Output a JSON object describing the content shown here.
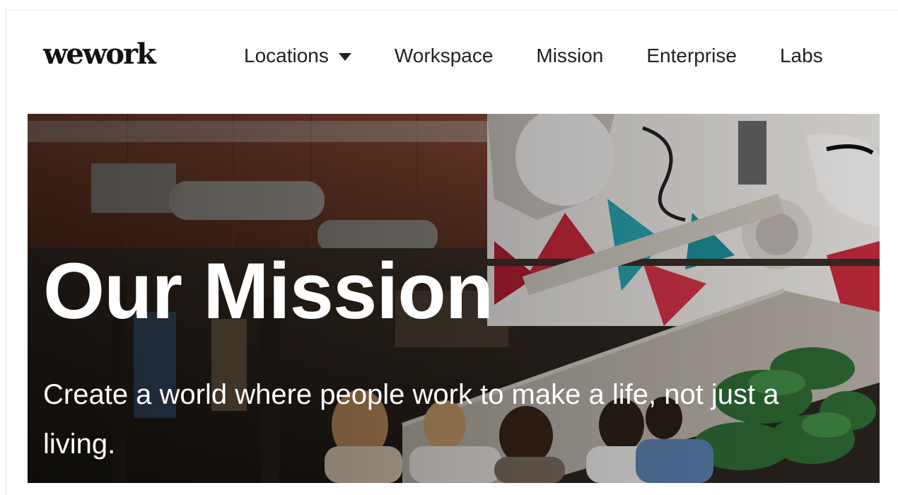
{
  "header": {
    "logo": "wework",
    "nav": [
      {
        "label": "Locations",
        "has_dropdown": true
      },
      {
        "label": "Workspace"
      },
      {
        "label": "Mission"
      },
      {
        "label": "Enterprise"
      },
      {
        "label": "Labs"
      }
    ]
  },
  "hero": {
    "title": "Our Mission",
    "subtitle": "Create a world where people work to make a life, not just a living.",
    "background_icon": "photo-office-mural"
  },
  "colors": {
    "text": "#222222",
    "hero_text": "#ffffff",
    "hero_bg": "#2c2520"
  }
}
